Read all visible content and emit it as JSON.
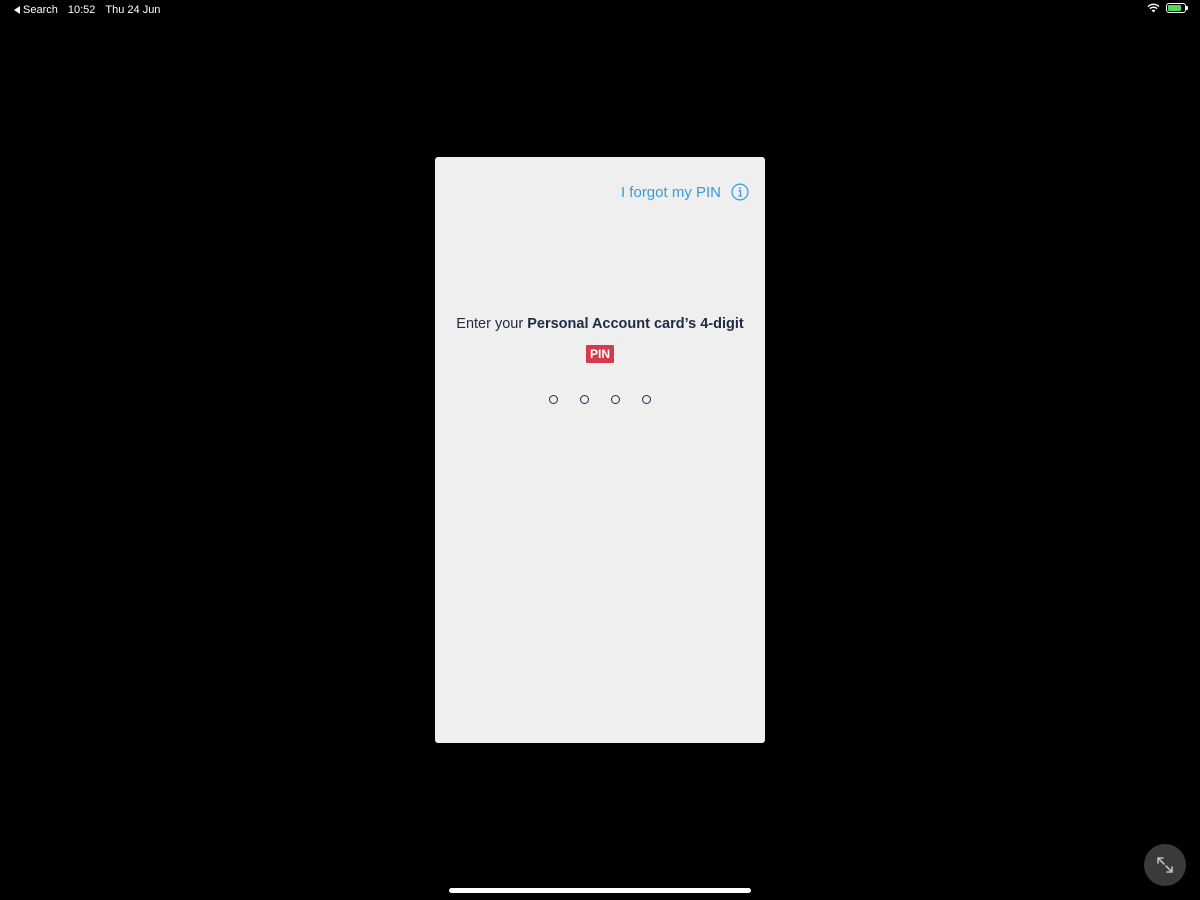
{
  "status_bar": {
    "back_app": "Search",
    "time": "10:52",
    "date": "Thu 24 Jun",
    "battery_level": 0.8
  },
  "pin_screen": {
    "forgot_pin_label": "I forgot my PIN",
    "prompt_prefix": "Enter your ",
    "prompt_bold": "Personal Account card’s 4-digit",
    "pin_badge": "PIN",
    "digits_entered": 0,
    "digits_total": 4
  },
  "icons": {
    "info": "info-icon",
    "expand": "expand-icon",
    "wifi": "wifi-icon",
    "battery": "battery-icon"
  },
  "colors": {
    "accent": "#3a9bd9",
    "badge": "#d83a4d",
    "card_background": "#efefef",
    "text": "#1f2a44"
  }
}
